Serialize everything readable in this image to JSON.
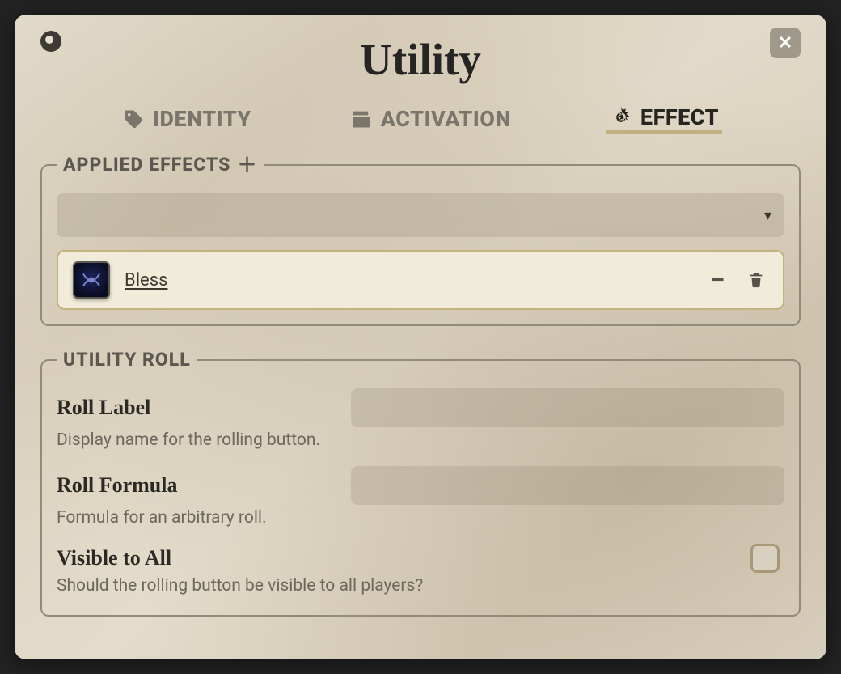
{
  "title": "Utility",
  "tabs": {
    "identity": "IDENTITY",
    "activation": "ACTIVATION",
    "effect": "EFFECT"
  },
  "active_tab": "effect",
  "applied_effects": {
    "legend": "APPLIED EFFECTS",
    "select_value": "",
    "items": [
      {
        "name": "Bless"
      }
    ]
  },
  "utility_roll": {
    "legend": "UTILITY ROLL",
    "roll_label": {
      "label": "Roll Label",
      "value": "",
      "hint": "Display name for the rolling button."
    },
    "roll_formula": {
      "label": "Roll Formula",
      "value": "",
      "hint": "Formula for an arbitrary roll."
    },
    "visible_all": {
      "label": "Visible to All",
      "checked": false,
      "hint": "Should the rolling button be visible to all players?"
    }
  }
}
